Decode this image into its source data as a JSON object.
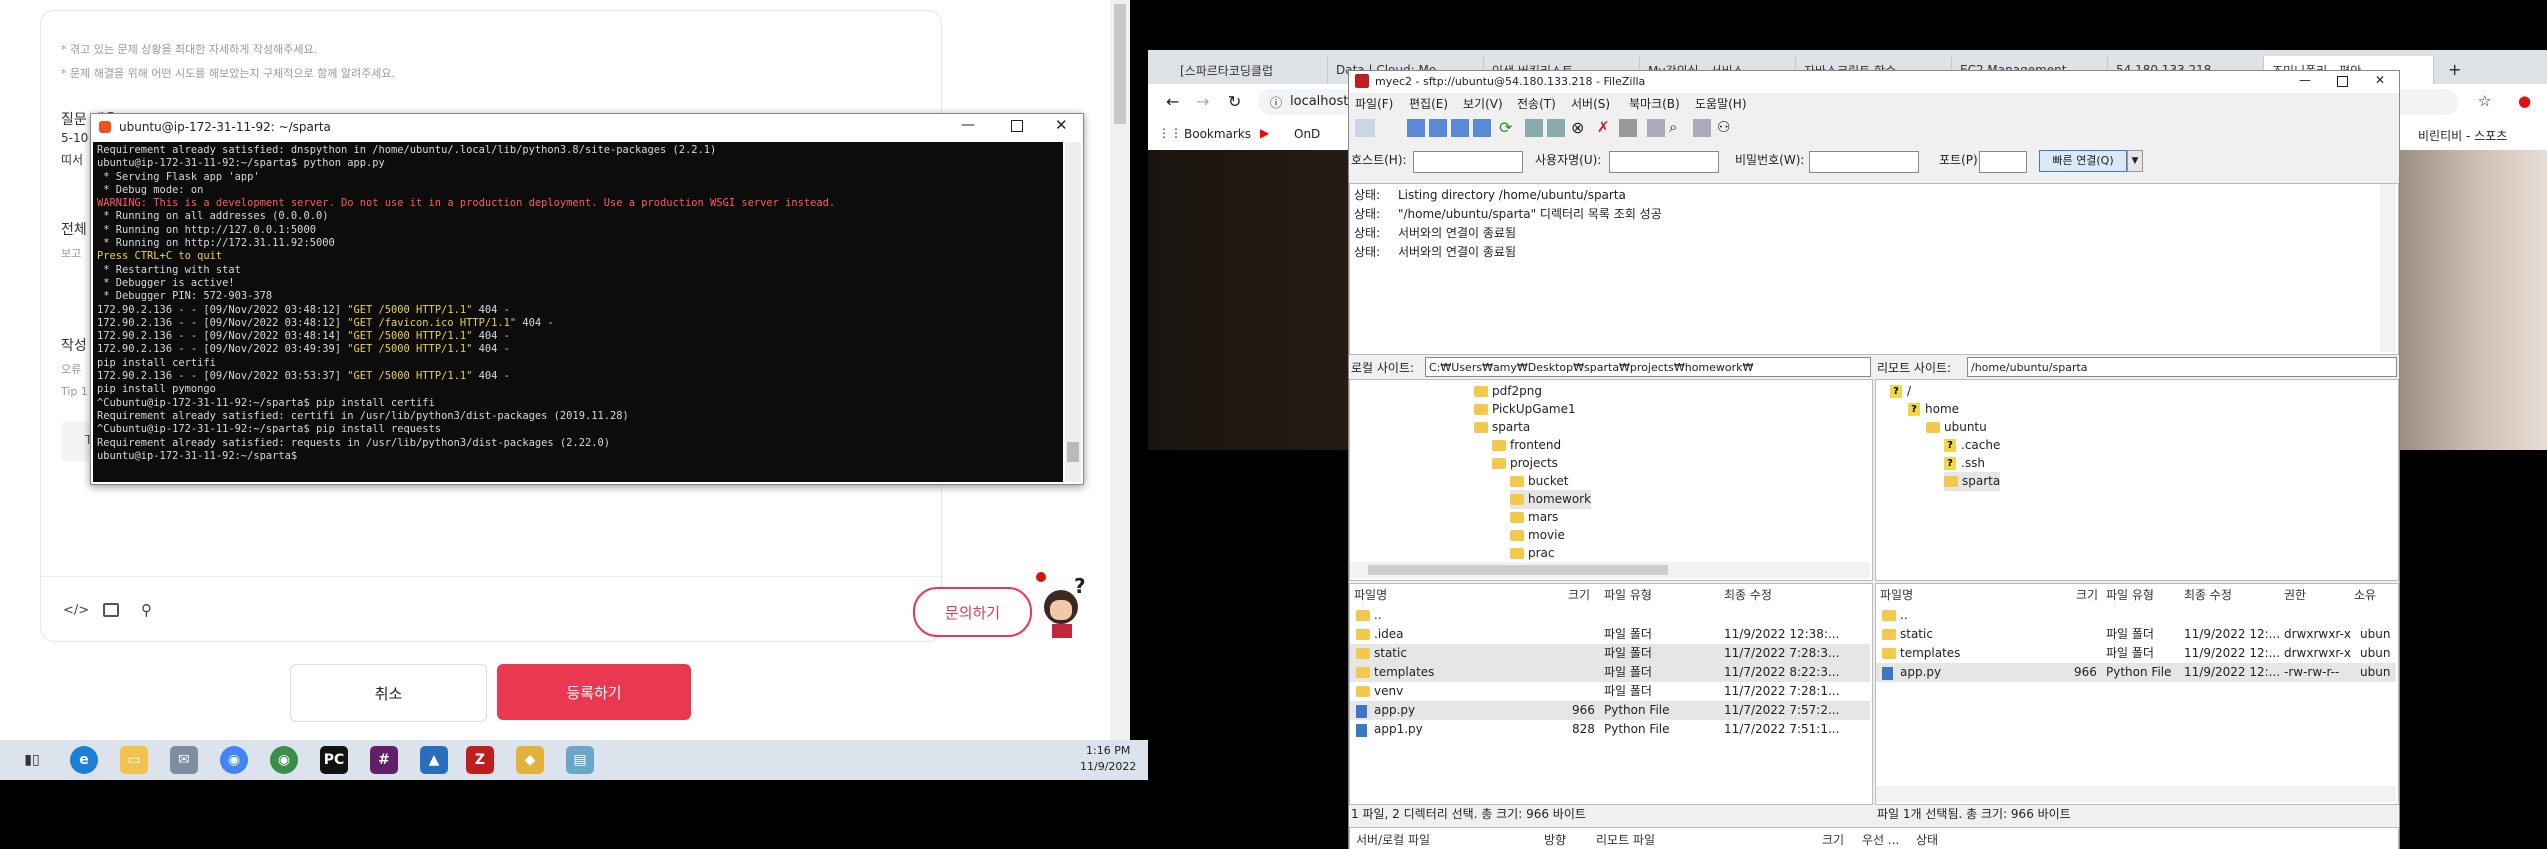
{
  "left_screen": {
    "page": {
      "hint1": "* 겪고 있는 문제 상황을 최대한 자세하게 작성해주세요.",
      "hint2": "* 문제 해결을 위해 어떤 시도를 해보았는지 구체적으로 함께 알려주세요.",
      "q_label": "질문 내용",
      "q_sub1": "5-10",
      "q_sub2": "띠서",
      "all_label": "전체",
      "all_sub": "보고",
      "write_label": "작성",
      "write_sub1": "오류",
      "write_sub2": "Tip 1",
      "write_sub3": "T",
      "cancel": "취소",
      "submit": "등록하기",
      "inquiry": "문의하기"
    },
    "terminal": {
      "title": "ubuntu@ip-172-31-11-92: ~/sparta",
      "lines": [
        {
          "t": "Requirement already satisfied: dnspython in /home/ubuntu/.local/lib/python3.8/site-packages (2.2.1)",
          "c": ""
        },
        {
          "t": "ubuntu@ip-172-31-11-92:~/sparta$ python app.py",
          "c": ""
        },
        {
          "t": " * Serving Flask app 'app'",
          "c": ""
        },
        {
          "t": " * Debug mode: on",
          "c": ""
        },
        {
          "t": "WARNING: This is a development server. Do not use it in a production deployment. Use a production WSGI server instead.",
          "c": "red"
        },
        {
          "t": " * Running on all addresses (0.0.0.0)",
          "c": ""
        },
        {
          "t": " * Running on http://127.0.0.1:5000",
          "c": ""
        },
        {
          "t": " * Running on http://172.31.11.92:5000",
          "c": ""
        },
        {
          "t": "Press CTRL+C to quit",
          "c": "yel"
        },
        {
          "t": " * Restarting with stat",
          "c": ""
        },
        {
          "t": " * Debugger is active!",
          "c": ""
        },
        {
          "t": " * Debugger PIN: 572-903-378",
          "c": ""
        },
        {
          "t": "172.90.2.136 - - [09/Nov/2022 03:48:12] \"GET /5000 HTTP/1.1\" 404 -",
          "c": "log"
        },
        {
          "t": "172.90.2.136 - - [09/Nov/2022 03:48:12] \"GET /favicon.ico HTTP/1.1\" 404 -",
          "c": "log"
        },
        {
          "t": "172.90.2.136 - - [09/Nov/2022 03:48:14] \"GET /5000 HTTP/1.1\" 404 -",
          "c": "log"
        },
        {
          "t": "172.90.2.136 - - [09/Nov/2022 03:49:39] \"GET /5000 HTTP/1.1\" 404 -",
          "c": "log"
        },
        {
          "t": "pip install certifi",
          "c": ""
        },
        {
          "t": "172.90.2.136 - - [09/Nov/2022 03:53:37] \"GET /5000 HTTP/1.1\" 404 -",
          "c": "log"
        },
        {
          "t": "pip install pymongo",
          "c": ""
        },
        {
          "t": "^Cubuntu@ip-172-31-11-92:~/sparta$ pip install certifi",
          "c": ""
        },
        {
          "t": "Requirement already satisfied: certifi in /usr/lib/python3/dist-packages (2019.11.28)",
          "c": ""
        },
        {
          "t": "^Cubuntu@ip-172-31-11-92:~/sparta$ pip install requests",
          "c": ""
        },
        {
          "t": "Requirement already satisfied: requests in /usr/lib/python3/dist-packages (2.22.0)",
          "c": ""
        },
        {
          "t": "ubuntu@ip-172-31-11-92:~/sparta$ ",
          "c": ""
        }
      ]
    },
    "taskbar": {
      "time": "1:16 PM",
      "date": "11/9/2022"
    }
  },
  "right_screen": {
    "chrome": {
      "tabs": [
        "[스파르타코딩클럽",
        "Data | Cloud: Mo",
        "인생 버킷리스트",
        "My강의실 - 서비스",
        "자바스크립트 함수",
        "EC2 Management",
        "54.180.133.218",
        "조미니폴리 - 편안"
      ],
      "url": "localhost",
      "bookmarks": [
        "Bookmarks",
        "OnD"
      ],
      "bookmark_right": "비린티비 - 스포츠"
    },
    "filezilla": {
      "title": "myec2 - sftp://ubuntu@54.180.133.218 - FileZilla",
      "menu": [
        "파일(F)",
        "편집(E)",
        "보기(V)",
        "전송(T)",
        "서버(S)",
        "북마크(B)",
        "도움말(H)"
      ],
      "quick": {
        "host_label": "호스트(H):",
        "user_label": "사용자명(U):",
        "pass_label": "비밀번호(W):",
        "port_label": "포트(P):",
        "connect": "빠른 연결(Q)"
      },
      "log": [
        {
          "k": "상태:",
          "v": "Listing directory /home/ubuntu/sparta"
        },
        {
          "k": "상태:",
          "v": "\"/home/ubuntu/sparta\" 디렉터리 목록 조회 성공"
        },
        {
          "k": "상태:",
          "v": "서버와의 연결이 종료됨"
        },
        {
          "k": "상태:",
          "v": "서버와의 연결이 종료됨"
        }
      ],
      "local_site_label": "로컬 사이트:",
      "local_site_path": "C:₩Users₩amy₩Desktop₩sparta₩projects₩homework₩",
      "remote_site_label": "리모트 사이트:",
      "remote_site_path": "/home/ubuntu/sparta",
      "local_tree": [
        {
          "name": "pdf2png",
          "depth": 2
        },
        {
          "name": "PickUpGame1",
          "depth": 2
        },
        {
          "name": "sparta",
          "depth": 2
        },
        {
          "name": "frontend",
          "depth": 3
        },
        {
          "name": "projects",
          "depth": 3
        },
        {
          "name": "bucket",
          "depth": 4
        },
        {
          "name": "homework",
          "depth": 4
        },
        {
          "name": "mars",
          "depth": 4
        },
        {
          "name": "movie",
          "depth": 4
        },
        {
          "name": "prac",
          "depth": 4
        }
      ],
      "remote_tree": [
        {
          "name": "/",
          "depth": 0
        },
        {
          "name": "home",
          "depth": 1
        },
        {
          "name": "ubuntu",
          "depth": 2
        },
        {
          "name": ".cache",
          "depth": 3
        },
        {
          "name": ".ssh",
          "depth": 3
        },
        {
          "name": "sparta",
          "depth": 3
        }
      ],
      "local_cols": [
        "파일명",
        "크기",
        "파일 유형",
        "최종 수정"
      ],
      "local_files": [
        {
          "name": "..",
          "size": "",
          "type": "",
          "mod": "",
          "kind": "folder"
        },
        {
          "name": ".idea",
          "size": "",
          "type": "파일 폴더",
          "mod": "11/9/2022 12:38:...",
          "kind": "folder"
        },
        {
          "name": "static",
          "size": "",
          "type": "파일 폴더",
          "mod": "11/7/2022 7:28:3...",
          "kind": "folder"
        },
        {
          "name": "templates",
          "size": "",
          "type": "파일 폴더",
          "mod": "11/7/2022 8:22:3...",
          "kind": "folder"
        },
        {
          "name": "venv",
          "size": "",
          "type": "파일 폴더",
          "mod": "11/7/2022 7:28:1...",
          "kind": "folder"
        },
        {
          "name": "app.py",
          "size": "966",
          "type": "Python File",
          "mod": "11/7/2022 7:57:2...",
          "kind": "py"
        },
        {
          "name": "app1.py",
          "size": "828",
          "type": "Python File",
          "mod": "11/7/2022 7:51:1...",
          "kind": "py"
        }
      ],
      "remote_cols": [
        "파일명",
        "크기",
        "파일 유형",
        "최종 수정",
        "권한",
        "소유"
      ],
      "remote_files": [
        {
          "name": "..",
          "size": "",
          "type": "",
          "mod": "",
          "perm": "",
          "own": "",
          "kind": "folder"
        },
        {
          "name": "static",
          "size": "",
          "type": "파일 폴더",
          "mod": "11/9/2022 12:...",
          "perm": "drwxrwxr-x",
          "own": "ubun",
          "kind": "folder"
        },
        {
          "name": "templates",
          "size": "",
          "type": "파일 폴더",
          "mod": "11/9/2022 12:...",
          "perm": "drwxrwxr-x",
          "own": "ubun",
          "kind": "folder"
        },
        {
          "name": "app.py",
          "size": "966",
          "type": "Python File",
          "mod": "11/9/2022 12:...",
          "perm": "-rw-rw-r--",
          "own": "ubun",
          "kind": "py"
        }
      ],
      "local_status": "1 파일, 2 디렉터리 선택. 총 크기: 966 바이트",
      "remote_status": "파일 1개 선택됨. 총 크기: 966 바이트",
      "queue_cols": [
        "서버/로컬 파일",
        "방향",
        "리모트 파일",
        "크기",
        "우선 ...",
        "상태"
      ]
    }
  }
}
